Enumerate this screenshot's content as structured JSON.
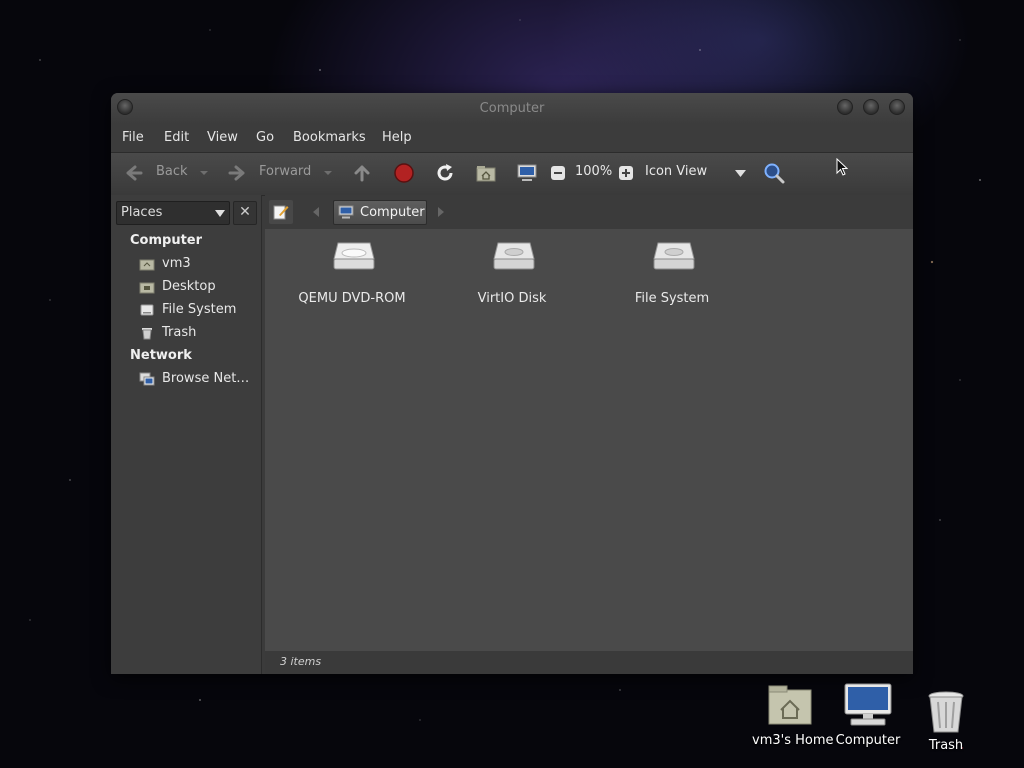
{
  "window": {
    "title": "Computer"
  },
  "menubar": {
    "items": [
      "File",
      "Edit",
      "View",
      "Go",
      "Bookmarks",
      "Help"
    ]
  },
  "toolbar": {
    "back_label": "Back",
    "forward_label": "Forward",
    "zoom_level": "100%",
    "view_mode": "Icon View"
  },
  "sidebar": {
    "places_label": "Places",
    "close_symbol": "✕",
    "sections": [
      {
        "heading": "Computer",
        "items": [
          {
            "label": "vm3",
            "icon": "home-folder-icon"
          },
          {
            "label": "Desktop",
            "icon": "desktop-folder-icon"
          },
          {
            "label": "File System",
            "icon": "drive-icon"
          },
          {
            "label": "Trash",
            "icon": "trash-icon"
          }
        ]
      },
      {
        "heading": "Network",
        "items": [
          {
            "label": "Browse Net…",
            "icon": "network-icon"
          }
        ]
      }
    ]
  },
  "pathbar": {
    "current": "Computer"
  },
  "files": [
    {
      "name": "QEMU DVD-ROM",
      "icon": "optical-drive-icon"
    },
    {
      "name": "VirtIO Disk",
      "icon": "hard-disk-icon"
    },
    {
      "name": "File System",
      "icon": "hard-disk-icon"
    }
  ],
  "statusbar": {
    "text": "3 items"
  },
  "desktop": {
    "icons": [
      {
        "label": "vm3's Home",
        "icon": "home-folder-icon"
      },
      {
        "label": "Computer",
        "icon": "computer-icon"
      },
      {
        "label": "Trash",
        "icon": "trash-icon"
      }
    ]
  },
  "colors": {
    "window_bg": "#3b3b3b",
    "content_bg": "#4a4a4a",
    "stop_red": "#b22222"
  }
}
